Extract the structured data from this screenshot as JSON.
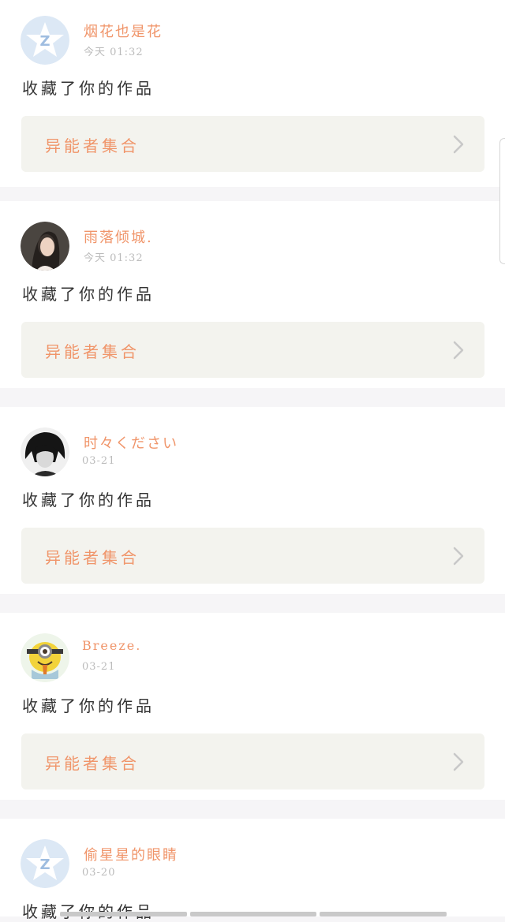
{
  "feed": {
    "items": [
      {
        "username": "烟花也是花",
        "time": "今天 01:32",
        "action": "收藏了你的作品",
        "work_title": "异能者集合",
        "avatar": "default-z-avatar"
      },
      {
        "username": "雨落倾城.",
        "time": "今天 01:32",
        "action": "收藏了你的作品",
        "work_title": "异能者集合",
        "avatar": "woman-photo-avatar"
      },
      {
        "username": "时々ください",
        "time": "03-21",
        "action": "收藏了你的作品",
        "work_title": "异能者集合",
        "avatar": "dark-hair-person-avatar"
      },
      {
        "username": "Breeze.",
        "time": "03-21",
        "action": "收藏了你的作品",
        "work_title": "异能者集合",
        "avatar": "minion-avatar"
      },
      {
        "username": "偷星星的眼睛",
        "time": "03-20",
        "action": "收藏了你的作品",
        "work_title": "",
        "avatar": "default-z-avatar"
      }
    ]
  },
  "colors": {
    "accent": "#f0956a",
    "card_bg": "#ffffff",
    "link_bg": "#f3f3ee",
    "page_bg": "#f6f5f7"
  }
}
